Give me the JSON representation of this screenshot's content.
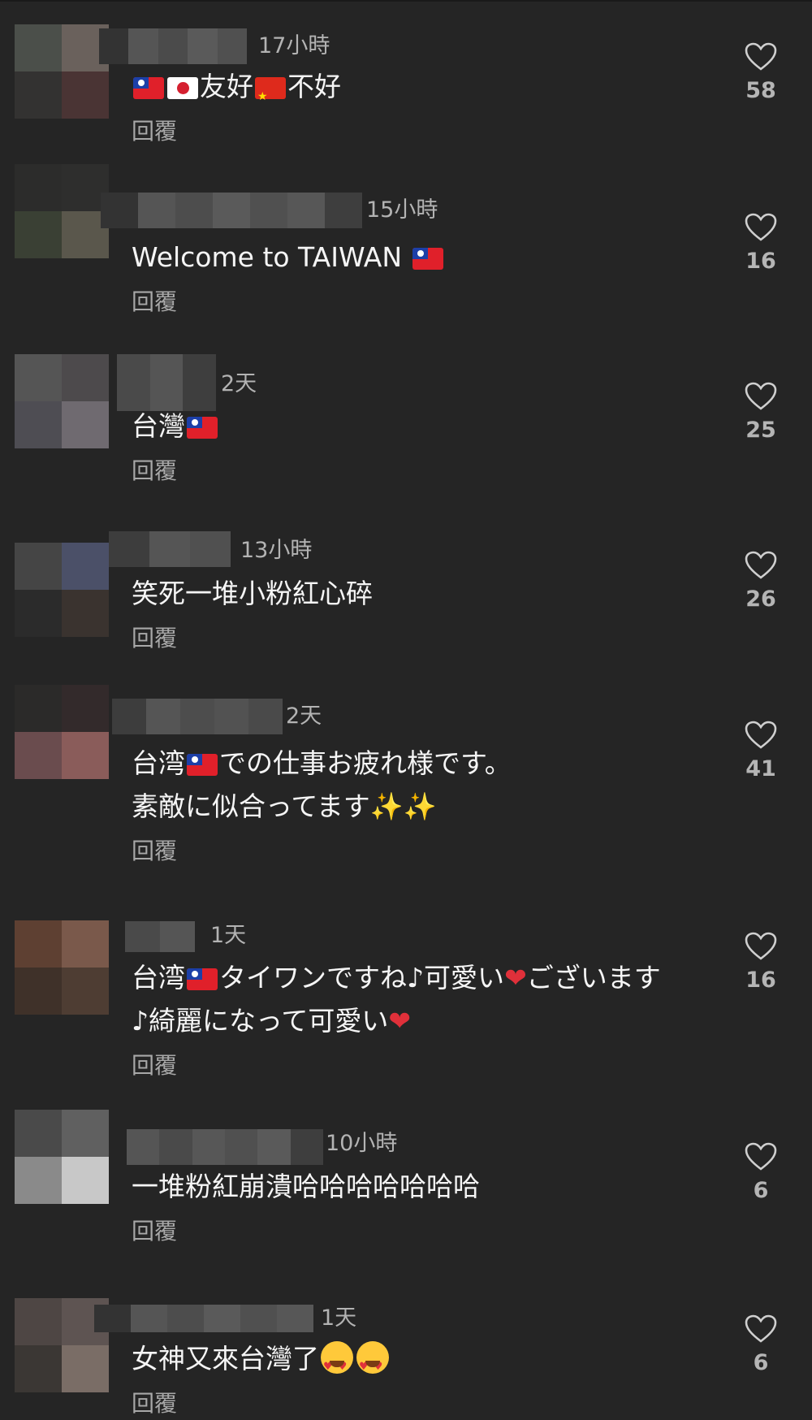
{
  "reply_label": "回覆",
  "colors": {
    "background": "#252525",
    "text": "#f5f5f5",
    "meta": "#b3b3b3"
  },
  "comments": [
    {
      "time": "17小時",
      "likes": "58",
      "parts": [
        "",
        "",
        "友好",
        "",
        "不好"
      ]
    },
    {
      "time": "15小時",
      "likes": "16",
      "parts": [
        "Welcome to TAIWAN ",
        ""
      ]
    },
    {
      "time": "2天",
      "likes": "25",
      "parts": [
        "台灣",
        ""
      ]
    },
    {
      "time": "13小時",
      "likes": "26",
      "parts": [
        "笑死一堆小粉紅心碎"
      ]
    },
    {
      "time": "2天",
      "likes": "41",
      "line1": [
        "台湾",
        "",
        "での仕事お疲れ様です。"
      ],
      "line2": [
        "素敵に似合ってます",
        "✨✨"
      ]
    },
    {
      "time": "1天",
      "likes": "16",
      "line1": [
        "台湾",
        "",
        "タイワンですね♪可愛い",
        "❤",
        "ございます"
      ],
      "line2": [
        "♪綺麗になって可愛い",
        "❤"
      ]
    },
    {
      "time": "10小時",
      "likes": "6",
      "parts": [
        "一堆粉紅崩潰哈哈哈哈哈哈哈"
      ]
    },
    {
      "time": "1天",
      "likes": "6",
      "parts": [
        "女神又來台灣了",
        "",
        ""
      ]
    }
  ],
  "icons": {
    "like": "heart-outline-icon"
  }
}
